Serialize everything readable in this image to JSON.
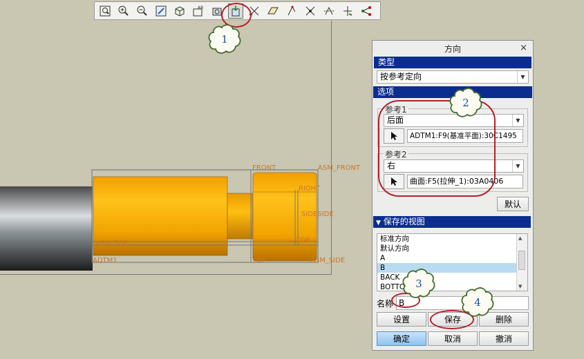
{
  "toolbar": {
    "icons": [
      "zoom-refit-icon",
      "zoom-in-icon",
      "zoom-out-icon",
      "repaint-icon",
      "saved-views-icon",
      "annotation-display-icon",
      "spin-center-icon",
      "reorient-icon",
      "datum-plane-display-icon",
      "datum-axis-display-icon",
      "point-display-icon",
      "coordinate-system-display-icon",
      "csys-display-icon",
      "datum-axis-tag-icon",
      "plane-tag-icon"
    ]
  },
  "model": {
    "labels": {
      "front": "FRONT",
      "asm_front": "ASM_FRONT",
      "right": "RIGHT",
      "side": "SIDESIDE",
      "asm_top": "ASM_TOP",
      "top_a": "TOP",
      "adtm1": "ADTM1",
      "top_b": "TOP",
      "asm_side": "ASM_SIDE"
    }
  },
  "callouts": [
    "1",
    "2",
    "3",
    "4"
  ],
  "dialog": {
    "title": "方向",
    "close": "×",
    "type_section": "类型",
    "type_value": "按参考定向",
    "options_section": "选项",
    "ref1": {
      "caption": "参考1",
      "direction": "后面",
      "reference": "ADTM1:F9(基准平面):30C1495"
    },
    "ref2": {
      "caption": "参考2",
      "direction": "右",
      "reference": "曲面:F5(拉伸_1):03A0406"
    },
    "default_button": "默认",
    "saved_views_section": "保存的视图",
    "saved_views": [
      "标准方向",
      "默认方向",
      "A",
      "B",
      "BACK",
      "BOTTOM"
    ],
    "selected_view": "B",
    "name_label": "名称",
    "name_value": "B",
    "set_button": "设置",
    "save_button": "保存",
    "delete_button": "删除",
    "ok_button": "确定",
    "cancel_button": "取消",
    "revert_button": "撤消"
  },
  "colors": {
    "section_bar": "#0b2d8f",
    "callout_ring": "#b3202a",
    "callout_text": "#1b4f9a",
    "part_orange": "#f2a400",
    "datum_label": "#c8782a"
  }
}
